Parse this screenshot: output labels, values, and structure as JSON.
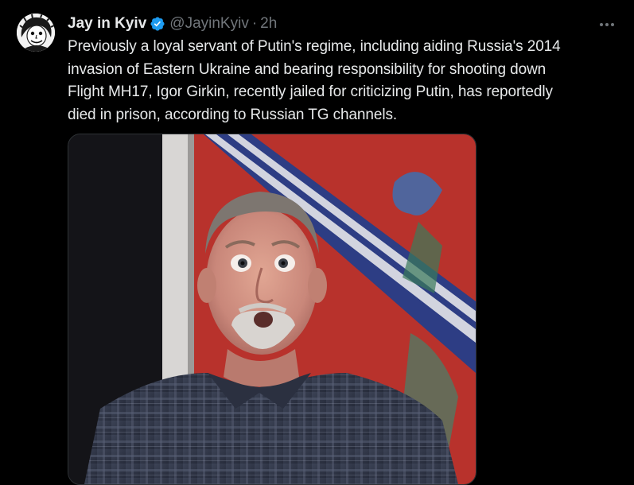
{
  "tweet": {
    "author": {
      "display_name": "Jay in Kyiv",
      "handle": "@JayinKyiv",
      "verified": true
    },
    "separator": "·",
    "timestamp": "2h",
    "text": "Previously a loyal servant of Putin's regime, including aiding Russia's 2014\ninvasion of Eastern Ukraine and bearing responsibility for shooting down\nFlight MH17, Igor Girkin, recently jailed for criticizing Putin, has reportedly\ndied in prison, according to Russian TG channels."
  },
  "icons": {
    "verified": "verified-badge-icon",
    "more": "more-options-icon"
  },
  "colors": {
    "background": "#000000",
    "primary_text": "#e7e9ea",
    "secondary_text": "#71767b",
    "verified_blue": "#1d9bf0"
  }
}
